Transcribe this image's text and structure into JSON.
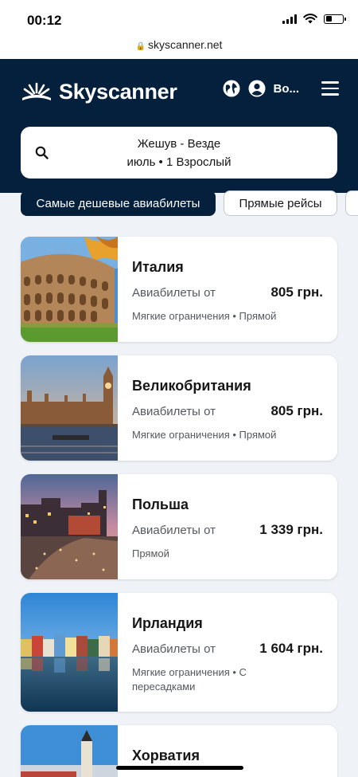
{
  "status": {
    "time": "00:12"
  },
  "browser": {
    "url": "skyscanner.net"
  },
  "header": {
    "brand": "Skyscanner",
    "user_label": "Во...",
    "search_route": "Жешув - Везде",
    "search_details": "июль  •  1 Взрослый"
  },
  "filters": {
    "cheapest": "Самые дешевые авиабилеты",
    "direct": "Прямые рейсы"
  },
  "destinations": [
    {
      "country": "Италия",
      "from": "Авиабилеты от",
      "price": "805 грн.",
      "tags": "Мягкие ограничения • Прямой"
    },
    {
      "country": "Великобритания",
      "from": "Авиабилеты от",
      "price": "805 грн.",
      "tags": "Мягкие ограничения • Прямой"
    },
    {
      "country": "Польша",
      "from": "Авиабилеты от",
      "price": "1 339 грн.",
      "tags": "Прямой"
    },
    {
      "country": "Ирландия",
      "from": "Авиабилеты от",
      "price": "1 604 грн.",
      "tags": "Мягкие ограничения • С пересадками"
    },
    {
      "country": "Хорватия",
      "from": "",
      "price": "",
      "tags": ""
    }
  ],
  "colors": {
    "header_bg": "#05203c",
    "page_bg": "#eff3f8",
    "chip_active": "#05203c"
  }
}
